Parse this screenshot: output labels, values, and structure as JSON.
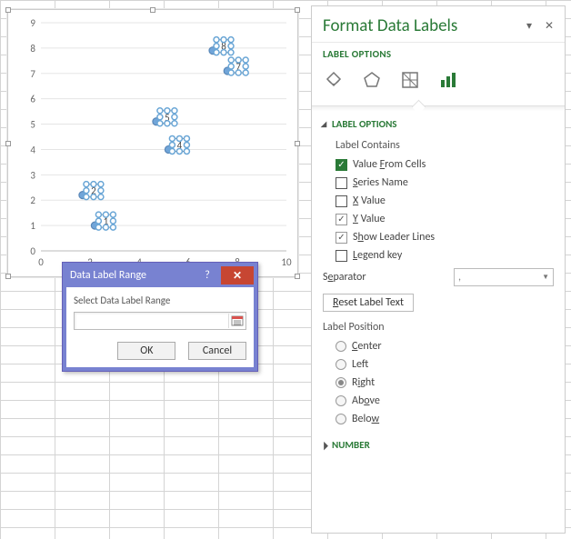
{
  "chart_data": {
    "type": "scatter",
    "xlabel": "",
    "ylabel": "",
    "xlim": [
      0,
      10
    ],
    "ylim": [
      0,
      9
    ],
    "xticks": [
      0,
      2,
      4,
      6,
      8,
      10
    ],
    "yticks": [
      0,
      1,
      2,
      3,
      4,
      5,
      6,
      7,
      8,
      9
    ],
    "points": [
      {
        "x": 2.2,
        "y": 1.0,
        "label": "1"
      },
      {
        "x": 1.7,
        "y": 2.2,
        "label": "2"
      },
      {
        "x": 5.2,
        "y": 4.0,
        "label": "4"
      },
      {
        "x": 4.7,
        "y": 5.1,
        "label": "5"
      },
      {
        "x": 7.6,
        "y": 7.1,
        "label": "7"
      },
      {
        "x": 7.0,
        "y": 7.9,
        "label": "8"
      }
    ]
  },
  "dialog": {
    "title": "Data Label Range",
    "prompt": "Select Data Label Range",
    "ok": "OK",
    "cancel": "Cancel"
  },
  "pane": {
    "title": "Format Data Labels",
    "subtitle": "LABEL OPTIONS",
    "section_label_options": "LABEL OPTIONS",
    "section_number": "NUMBER",
    "label_contains": "Label Contains",
    "opt_value_from_cells": "Value From Cells",
    "opt_series_name": "Series Name",
    "opt_x_value": "X Value",
    "opt_y_value": "Y Value",
    "opt_leader_lines": "Show Leader Lines",
    "opt_legend_key": "Legend key",
    "separator_label": "Separator",
    "separator_value": ",",
    "reset_label": "Reset Label Text",
    "label_position": "Label Position",
    "pos_center": "Center",
    "pos_left": "Left",
    "pos_right": "Right",
    "pos_above": "Above",
    "pos_below": "Below"
  }
}
